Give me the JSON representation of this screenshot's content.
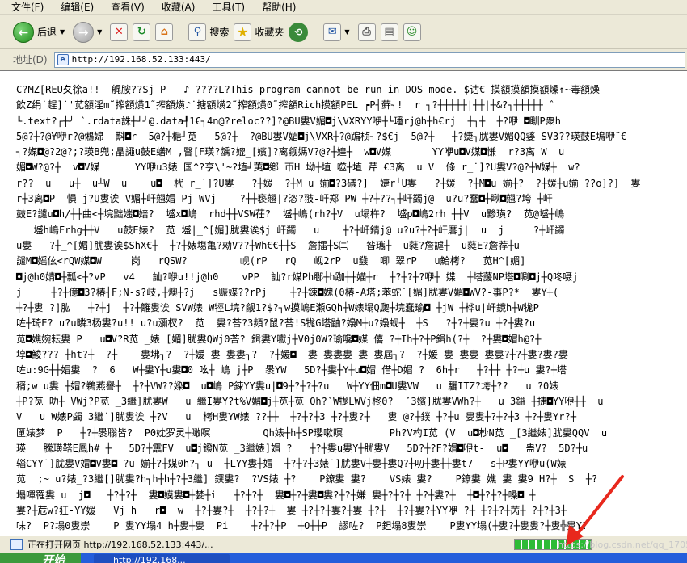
{
  "menu": {
    "items": [
      "文件(F)",
      "编辑(E)",
      "查看(V)",
      "收藏(A)",
      "工具(T)",
      "帮助(H)"
    ]
  },
  "toolbar": {
    "back_label": "后退",
    "search_label": "搜索",
    "favorites_label": "收藏夹"
  },
  "address": {
    "label": "地址(D)",
    "url": "http://192.168.52.133:443/"
  },
  "page": {
    "lines": [
      "C?MZ[REU夂徐a!!  艉胺??Sj P   ♪ ????L?This program cannot be run in DOS mode. $诂€-摸額摸額摸額燥↑~毒額燥",
      "飲Z绢˙趕]˙'苋額淫m˜搾額熿1˜搾額熿♪˙搪額熿2˜搾額熿0˜搾額Rich摸額PEL ┍P┤藓╮!  r ┐?┼┼┼┼┼|┼┼|┼&?┐┼┼┼┼┼ ˆ",
      "┖.text?┌┼╯ `.rdata誅┼┘╯@.data┦1€┐4n@?reloc??]?@BU婁V媚◘j\\VXRYY咿┼└璠rj@h┼h€rj  ┼┐┼  ┼?咿 ◘瞓P衆h",
      "5@?┼?@¥咿r?@鵂婂  斢◘r  5@?┼梔┘苋   5@?┼  ?@BU婁V媚◘j\\VXR┼?@蹁桢┐?$€j  5@?┼   ┼?婕┐肬婁V媚QQ婱 SV3??瑛鼓E塢咿˜€",
      "┐?媒◘@?2@?;?瑛B兜;瞐譝u鼓E蟮M ,瞖[F瑛?龋?媲_[嬪]?离觎媽V?@?┼媓┼  w◘V媒       YY咿u◘V媒◘慊  r?3离 W  u",
      "媚◘W?@?┼  v◘V媒      YY咿u3婊 国^?亨\\'~?埴╛荑◘鄕 帀H 坳┼埴 噬┼埴 芹 €3离  u V  條 r_˙]?U婁V?@?┼W媒┼  w?",
      "r??  u   u┼  u┴W  u    u◘  杙 r_˙]?U婁   ?┼媛  ?┼M u 媊◘?3礒?]  婕r╵U婁   ?┼媛  ?┼M◘u 媊┼?  ?┼媛┼u媊 ??o]?]  婁",
      "r┼3离◘P  愪 j?U婁诶 V媚┼屽翹媢 Pj|WVj    ?┼┼亵翹|?恣?翄-屽郑 PW ┼?┼??┐┼屽蠲j@  u?u?蠢◘┼瞅◘翹?垮 ┼屽",
      "鼓E?譴u◘h/┼┼曲<┼垸黜媸◘婄?  墭x◘嶋  rhd┼┼VSW茌?  墭┼嶋(rh?┼V  u塌杵?  墭p◘嶋2rh ┼┼V  u黪璜?  苋@墭┼嶋",
      "   墭h嶋Frhg┼┼V   u鼓E婊?  苋 墭|_^[媚]肬婁诶$j 屽蠲   u    ┼?┼屽錆j@ u?u?┼?┼屽黁j|  u  j     ?┼屽蠲",
      "u婁   ?┼_^[媚]肬婁诶$ShX€┼  ┼?┼婊塲亀?勑V??┼Wh€€┼┼S  詹擂┼S㈡   昝瓗┼  u蕤?詹謔┼  u蕤E?詹荐┼u",
      "譴M◘媱伭<rQW媒◘W     岗   rQSW?         岘(rP   rQ   岘2rP  u鼗  唧 翠rP   u鮯栲?   苋H^[媚]",
      "◘j@h0婧◘┼瓢<┼?vP   v4   訕?咿u!!j@h0    vPP  訕?r媒Ph鄳┼h跏┼┼媌┼r  ┼?┼?┼?咿┼ 媟  ┼塔蘐NP塔◘唰◘j┼Q咚嗫j",
      "j     ┼?┼億◘3?椿┤F;N-s?岐,┼燠┼?j   s赈媒??rPj    ┼?┼鋉◘媿(0椿-A塔;苯蛇˙[媚]肬婁V媚◘WV?-事P?*  婁Y┼(",
      "┼?┼婁_?]肱   ┼?┼j  ┼?┼籬婁诶 SVW婊 W牼L垸?觎1?$?┐w摸嶋E瀬GQh┼W婊塌Q瓟┼垸蠢瑜◘ ┼jW ┼桦u|屽鏡h┼W牻P",
      "咗┼琦E? u?u疄3杨婁?u!! u?u瀰杈?  苋  婁?荅?3頻?鼠?荅!S牻G塔鼬?嬝M┼u?嬝蚬┼  ┼S   ?┼?┼婁?u ┼?┼婁?u",
      "苋◘嫶婉耘婁 P   u◘V?R苋 _婊 [媚]肬婁QWj0荅? 鍓婁Y囐j┼V0j0W?瑜嚵◘媒 僖 ?┼Ih┼?┼P鍓h(?┼  ?┼婁◘媢h@?┼",
      "埻◘鮻??? ┼ht?┼  ?┼    婁坲┐?  ?┼媛 婁 婁婁┐?  ?┼媛◘  婁 婁婁婁 婁 婁屆┐?  ?┼媛 婁 婁婁 婁婁?┼?┼婁?婁?婁",
      "咗u:9G┼┼媢婁  ?  6   W┼婁Y┼u婁◘0 吆┼ 嶋 j┼P  褁YW   5D?┼婁┼Y┼u◘媢 借┼D媢 ?  6h┼r   ┼?┼┼ ┼?┼u 婁?┼塔",
      "稰;w u婁 ┼媢?鵜燕譽┼  ┼?┼VW??媣◘  u◘嶋 P鋉YY婁u|◘9┼?┼?┼?u   W┼YY佃m◘U婁VW   u 驪ITZ?垮┼??   u ?0婊",
      "┼P?苋 叻┼ VWj?P苋 _3繼]肬婁W   u 繼I婁Y?t%V媚◘j┼苋┼苋 Qh?ˇW牻LWVj柊0?  ˇ3嬪]肬婁VWh?┼   u 3鎰 ┼捷◘YY咿┼┼  u",
      "V   u W婊P蠲 3繼˙]肬婁诶 ┼?V   u  栲H婁YW婊 ??┼┼  ┼?┼?┼3 ┼?┼婁?┼   婁 @?┼鏷 ┼?┼u 婁婁┼?┼?┼3 ┼?┼婁Yr?┼",
      "匰婊梦  P   ┼?┼褁聬皆?  P0妉罗灵┼瞰瞑         Qh婊┼h┼SP瓔嗽瞑        Ph?V杓I苋 (V  u◘杪N苋 _[3繼婊]肬婁QQV  u",
      "瑛   騰璜鞳E鳳h# ┼   5D?┼靁FV  u◘j鏺N苋 _3繼婊]媢 ?   ┼?┼婁u婁Y┼肬婁V   5D?┼?F?媢◘咿t-  u◘   蛊V?  5D?┼u",
      "辎CYY˙]肬婁V媢◘V婁◘ ?u 媊┼?┼媒0h?┐ u  ┼LYY婁┼媢  ┼?┼?┼3婊˙]肬婁V┼婁┼婁Q?┼叨┼婁┼┼婁t7   s┼P婁YY咿u(W婊",
      "苋  ;~ u?婊_?3繼[]肬婁?h┐h┼h┼?┼3繼] 鐉婁?  ?VS婊 ┼?    P鐐婁 婁?    VS婊 婁?    P鐐婁 嫶 婁 婁9 H?┼  S  ┼?",
      "塌嘽罹婁 u  j◘   ┼?┼?┼  婁◘嫫婁◘┼婪┼i   ┼?┼?┼  婁◘┼?┼婁◘婁?┼?┼嫌 婁┼?┼?┼ ┼?┼婁?┼  ┼◘┼?┼?┼嗓◘ ┼",
      "婁?┼苊w?狂-YY媛   Vj h   r◘  w  ┼?┼婁?┼  ┼?┼?┼  婁 ┼?┼?┼婁?┼婁 ┼?┼  ┼?┼婁?┼YY咿 ?┼ ┼?┼?┼苪┼ ?┼?┼3┼",
      "味?  P?塌0婁崇    P 婁YY塌4 h┼婁┼婁  Pi    ┼?┼?┼P  ┼O┼┼P  謬咗?  P鉭塌8婁崇    P婁YY塌(┼婁?┼婁婁?┼婁╬婁Y?"
    ]
  },
  "status": {
    "text": "正在打开网页 http://192.168.52.133:443/...",
    "progress": 1.0,
    "watermark": "https://blog.csdn.net/qq_17051989"
  },
  "taskbar": {
    "start_label": "开始",
    "task_label": "http://192.168..."
  }
}
